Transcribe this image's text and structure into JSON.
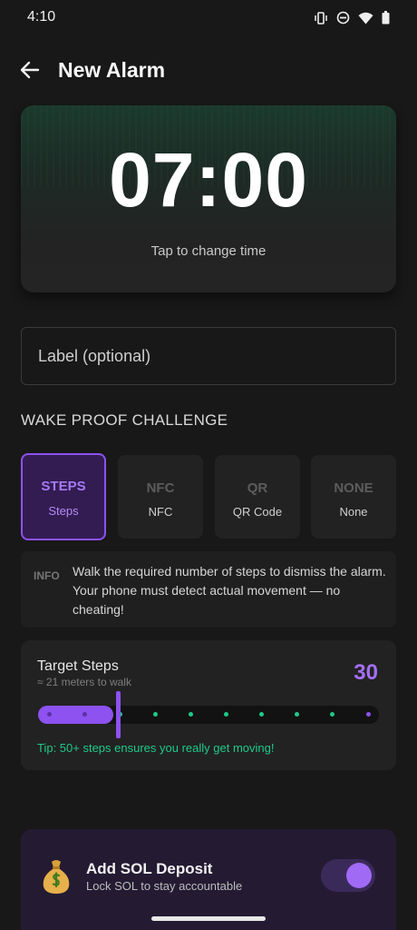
{
  "status_bar": {
    "time": "4:10",
    "icons": [
      "vibrate-icon",
      "dnd-icon",
      "wifi-icon",
      "battery-icon"
    ]
  },
  "app_bar": {
    "back_icon": "arrow-left-icon",
    "title": "New Alarm"
  },
  "time_card": {
    "time": "07:00",
    "hint": "Tap to change time"
  },
  "label_field": {
    "placeholder": "Label (optional)",
    "value": ""
  },
  "challenge_section": {
    "title": "WAKE PROOF CHALLENGE",
    "options": [
      {
        "code": "STEPS",
        "name": "Steps",
        "selected": true
      },
      {
        "code": "NFC",
        "name": "NFC",
        "selected": false
      },
      {
        "code": "QR",
        "name": "QR Code",
        "selected": false
      },
      {
        "code": "NONE",
        "name": "None",
        "selected": false
      }
    ],
    "info_tag": "INFO",
    "info_text": "Walk the required number of steps to dismiss the alarm. Your phone must detect actual movement — no cheating!"
  },
  "steps_card": {
    "title": "Target Steps",
    "subtitle": "≈ 21 meters to walk",
    "value": "30",
    "slider_fraction": 0.22,
    "tip": "Tip: 50+ steps ensures you really get moving!"
  },
  "deposit_card": {
    "icon": "money-bag-icon",
    "title": "Add SOL Deposit",
    "subtitle": "Lock SOL to stay accountable",
    "enabled": true
  },
  "colors": {
    "accent": "#8d52f0",
    "accent_text": "#a36ff5",
    "tip_green": "#1fc98c",
    "background": "#181818"
  }
}
